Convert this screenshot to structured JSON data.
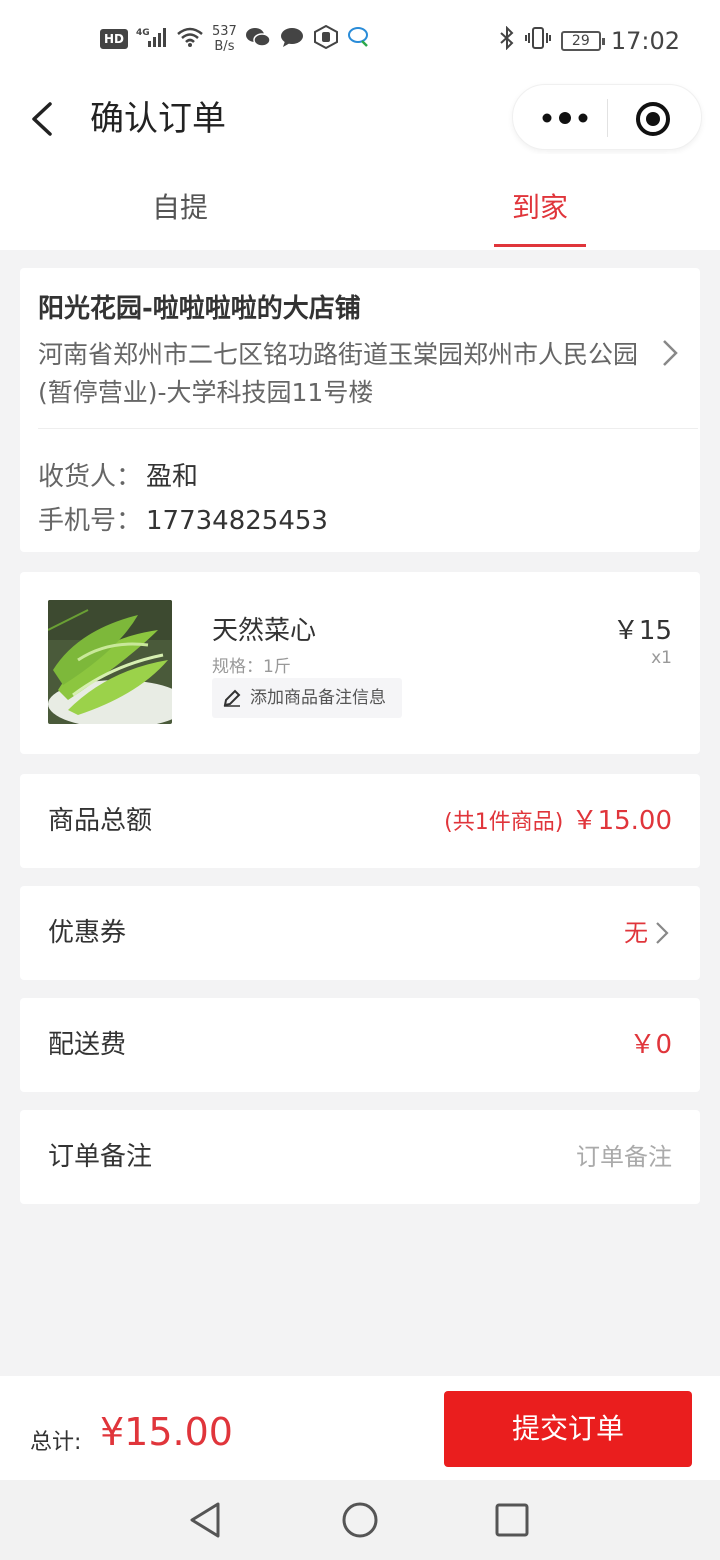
{
  "status_bar": {
    "hd": "HD",
    "network": "4G",
    "speed_value": "537",
    "speed_unit": "B/s",
    "battery": "29",
    "time": "17:02"
  },
  "nav": {
    "title": "确认订单"
  },
  "tabs": [
    {
      "label": "自提",
      "active": false
    },
    {
      "label": "到家",
      "active": true
    }
  ],
  "store": {
    "name": "阳光花园-啦啦啦啦的大店铺",
    "address": "河南省郑州市二七区铭功路街道玉棠园郑州市人民公园(暂停营业)-大学科技园11号楼",
    "receiver_label": "收货人：",
    "receiver_name": "盈和",
    "phone_label": "手机号：",
    "phone": "17734825453"
  },
  "product": {
    "name": "天然菜心",
    "spec": "规格：1斤",
    "note_button": "添加商品备注信息",
    "price": "￥15",
    "qty": "x1"
  },
  "summary": {
    "total_label": "商品总额",
    "total_count": "(共1件商品)",
    "total_value": "￥15.00",
    "coupon_label": "优惠券",
    "coupon_value": "无",
    "shipping_label": "配送费",
    "shipping_value": "￥0",
    "remark_label": "订单备注",
    "remark_placeholder": "订单备注"
  },
  "footer": {
    "total_label": "总计:",
    "total_value": "¥15.00",
    "submit_label": "提交订单"
  },
  "colors": {
    "accent": "#e0353b",
    "submit_bg": "#ea1e1e",
    "background": "#f3f3f4"
  },
  "icons": {
    "back": "back-arrow-icon",
    "more": "more-dots-icon",
    "close": "target-close-icon",
    "chevron": "chevron-right-icon",
    "pencil": "pencil-icon"
  }
}
